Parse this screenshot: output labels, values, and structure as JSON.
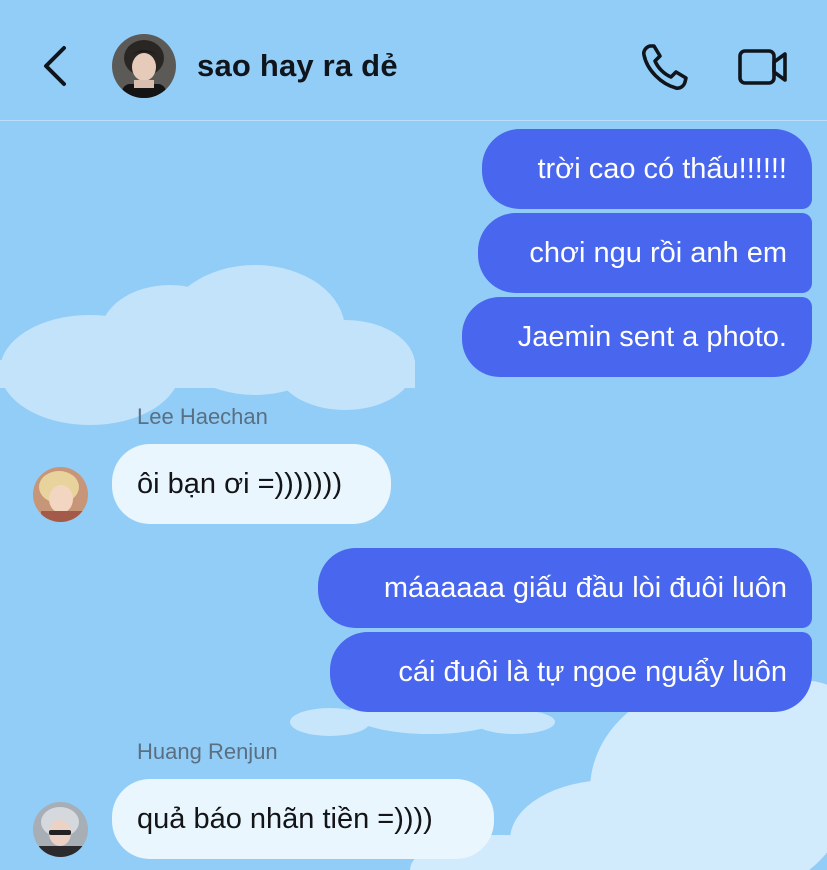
{
  "header": {
    "back_icon": "chevron-left-icon",
    "title": "sao hay ra dẻ",
    "call_icon": "phone-icon",
    "video_icon": "video-camera-icon"
  },
  "theme": {
    "background": "#92cdf7",
    "outgoing_bubble": "#4866ee",
    "incoming_bubble": "#e9f6fd"
  },
  "messages": {
    "m1": "trời cao có thấu!!!!!!",
    "m2": "chơi ngu rồi anh em",
    "m3": "Jaemin sent a photo.",
    "haechan_name": "Lee Haechan",
    "m4": "ôi bạn ơi =)))))))",
    "m5": "máaaaaa giấu đầu lòi đuôi luôn",
    "m6": "cái đuôi là tự ngoe nguẩy luôn",
    "renjun_name": "Huang Renjun",
    "m7": "quả báo nhãn tiền =))))"
  }
}
